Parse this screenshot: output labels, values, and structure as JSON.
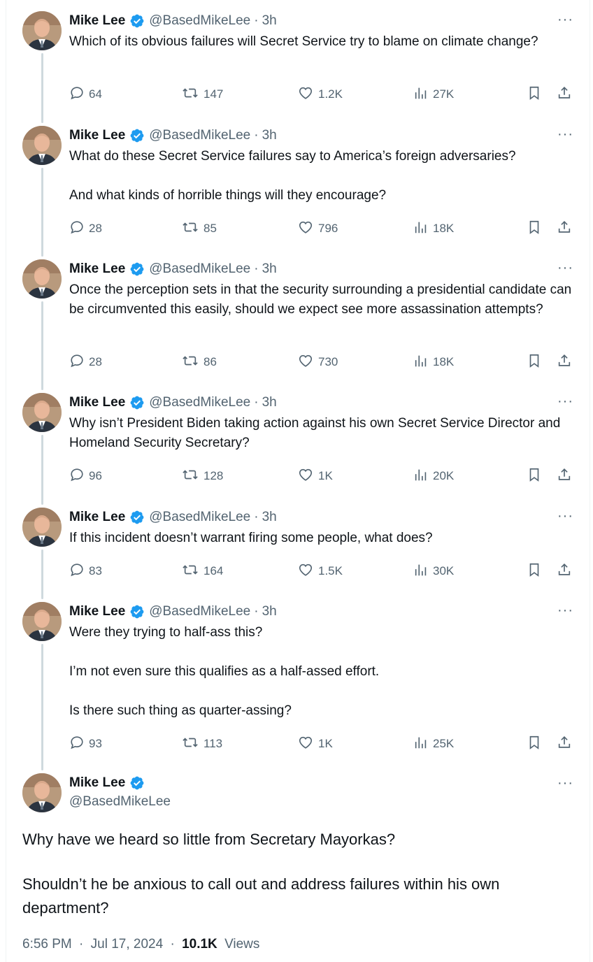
{
  "author": {
    "name": "Mike Lee",
    "handle": "@BasedMikeLee",
    "verified_color": "#1d9bf0"
  },
  "tweets": [
    {
      "time": "3h",
      "text": [
        "Which of its obvious failures will Secret Service try to blame on climate change?"
      ],
      "replies": "64",
      "retweets": "147",
      "likes": "1.2K",
      "views": "27K"
    },
    {
      "time": "3h",
      "text": [
        "What do these Secret Service failures say to America’s foreign adversaries?",
        "And what kinds of horrible things will they encourage?"
      ],
      "replies": "28",
      "retweets": "85",
      "likes": "796",
      "views": "18K"
    },
    {
      "time": "3h",
      "text": [
        "Once the perception sets in that the security surrounding a presidential candidate can be circumvented this easily, should we expect see more assassination attempts?"
      ],
      "replies": "28",
      "retweets": "86",
      "likes": "730",
      "views": "18K"
    },
    {
      "time": "3h",
      "text": [
        "Why isn’t President Biden taking action against his own Secret Service Director and Homeland Security Secretary?"
      ],
      "replies": "96",
      "retweets": "128",
      "likes": "1K",
      "views": "20K"
    },
    {
      "time": "3h",
      "text": [
        "If this incident doesn’t warrant firing some people, what does?"
      ],
      "replies": "83",
      "retweets": "164",
      "likes": "1.5K",
      "views": "30K"
    },
    {
      "time": "3h",
      "text": [
        "Were they trying to half-ass this?",
        "I’m not even sure this qualifies as a half-assed effort.",
        "Is there such thing as quarter-assing?"
      ],
      "replies": "93",
      "retweets": "113",
      "likes": "1K",
      "views": "25K"
    }
  ],
  "main_tweet": {
    "text": [
      "Why have we heard so little from Secretary Mayorkas?",
      "Shouldn’t he be anxious to call out and address failures within his own department?"
    ],
    "time": "6:56 PM",
    "date": "Jul 17, 2024",
    "views_count": "10.1K",
    "views_label": "Views"
  },
  "more_glyph": "···",
  "separator": "·"
}
